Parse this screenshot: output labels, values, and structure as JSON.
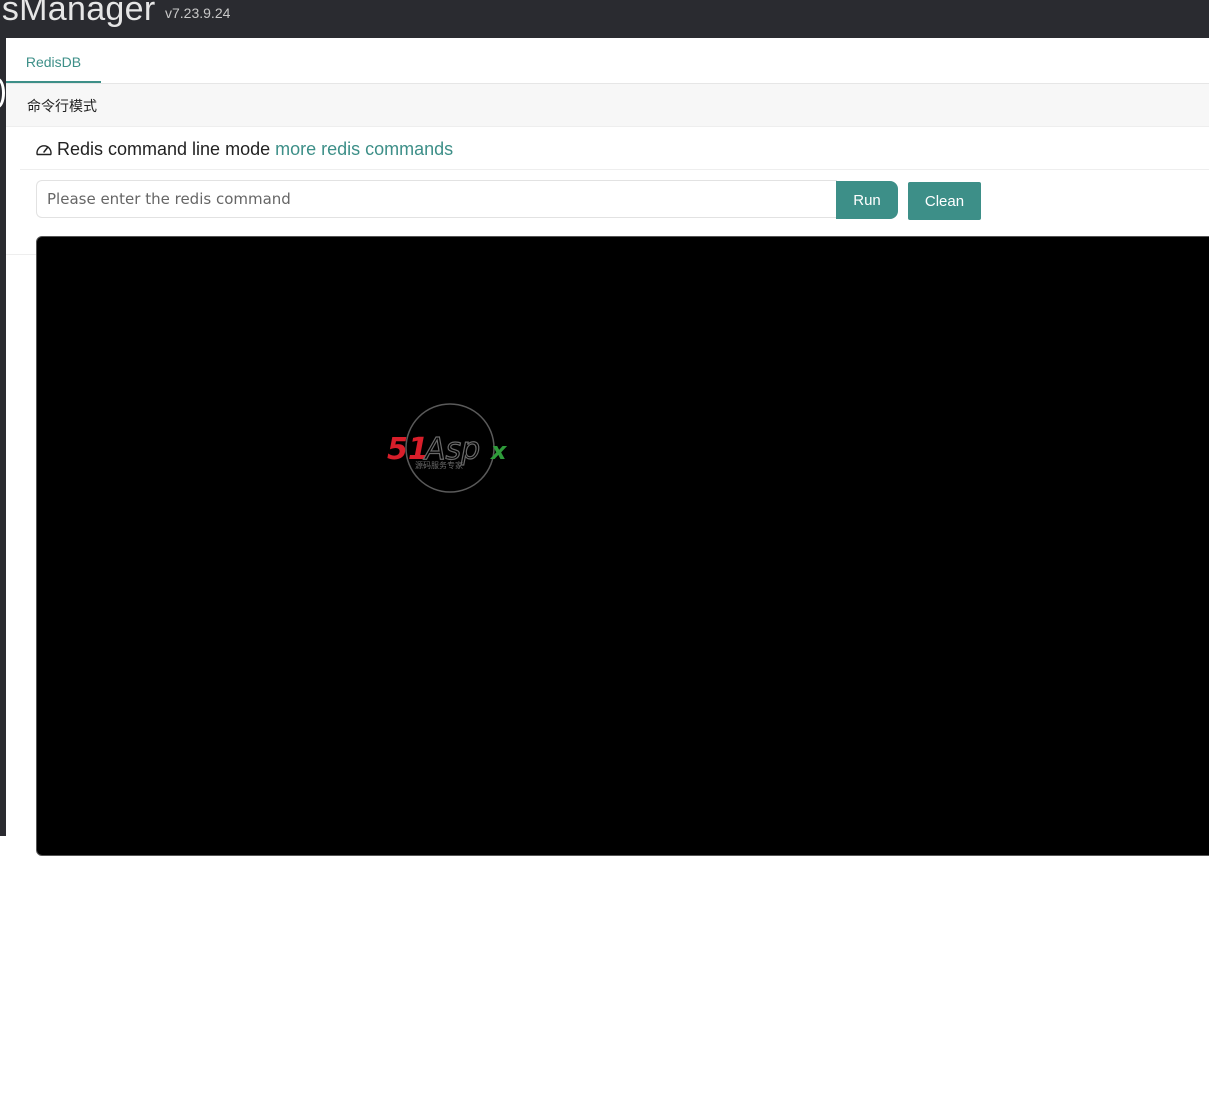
{
  "app": {
    "title": "isManager",
    "version": "v7.23.9.24"
  },
  "tabs": [
    {
      "label": "RedisDB",
      "active": true
    }
  ],
  "card": {
    "header": "命令行模式",
    "title": "Redis command line mode",
    "title_icon": "dashboard-icon",
    "more_link": "more redis commands"
  },
  "command": {
    "placeholder": "Please enter the redis command",
    "value": "",
    "run_label": "Run",
    "clean_label": "Clean"
  },
  "console": {
    "output": "",
    "watermark": {
      "brand": "51Aspx",
      "tagline": "源码服务专家"
    }
  },
  "colors": {
    "accent": "#3d8f88",
    "header_bg": "#2a2b30",
    "console_bg": "#000000",
    "logo_red": "#d81e2a",
    "logo_green": "#2e9b3a"
  }
}
